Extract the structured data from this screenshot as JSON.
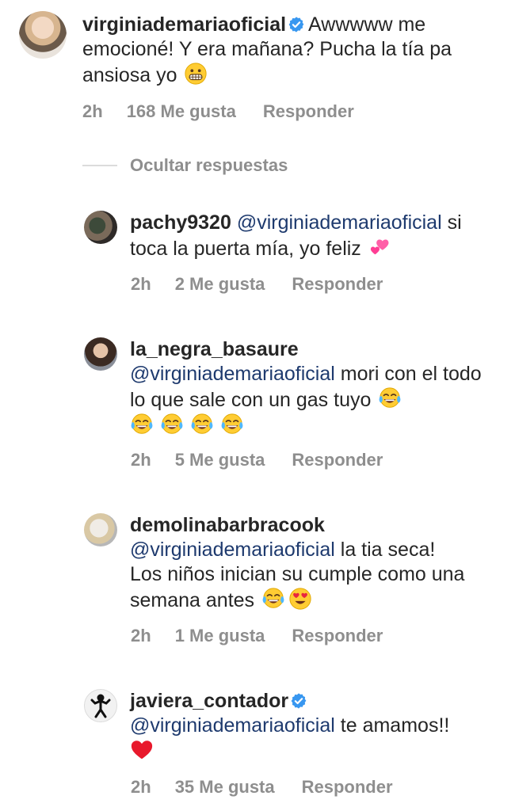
{
  "main_comment": {
    "username": "virginiademariaoficial",
    "verified": true,
    "text": "Awwwww me emocioné! Y era mañana? Pucha la tía pa ansiosa yo",
    "emojis": [
      "grimacing-face"
    ],
    "time": "2h",
    "likes": "168 Me gusta",
    "reply": "Responder"
  },
  "hide_replies": "Ocultar respuestas",
  "replies": [
    {
      "username": "pachy9320",
      "verified": false,
      "mention": "@virginiademariaoficial",
      "text": "si toca la puerta mía, yo feliz",
      "emojis": [
        "two-hearts"
      ],
      "time": "2h",
      "likes": "2 Me gusta",
      "reply": "Responder"
    },
    {
      "username": "la_negra_basaure",
      "verified": false,
      "mention": "@virginiademariaoficial",
      "text": "mori con el todo lo que sale con un gas tuyo",
      "emojis": [
        "tears-of-joy",
        "tears-of-joy",
        "tears-of-joy",
        "tears-of-joy",
        "tears-of-joy"
      ],
      "time": "2h",
      "likes": "5 Me gusta",
      "reply": "Responder"
    },
    {
      "username": "demolinabarbracook",
      "verified": false,
      "mention": "@virginiademariaoficial",
      "text": "la tia seca! Los niños inician su cumple como una semana antes",
      "emojis": [
        "tears-of-joy",
        "heart-eyes"
      ],
      "time": "2h",
      "likes": "1 Me gusta",
      "reply": "Responder"
    },
    {
      "username": "javiera_contador",
      "verified": true,
      "mention": "@virginiademariaoficial",
      "text": "te amamos!!",
      "emojis": [
        "red-heart"
      ],
      "time": "2h",
      "likes": "35 Me gusta",
      "reply": "Responder"
    }
  ],
  "colors": {
    "text": "#262626",
    "meta": "#8e8e8e",
    "mention": "#1e3a6e",
    "verified": "#3897f0"
  }
}
